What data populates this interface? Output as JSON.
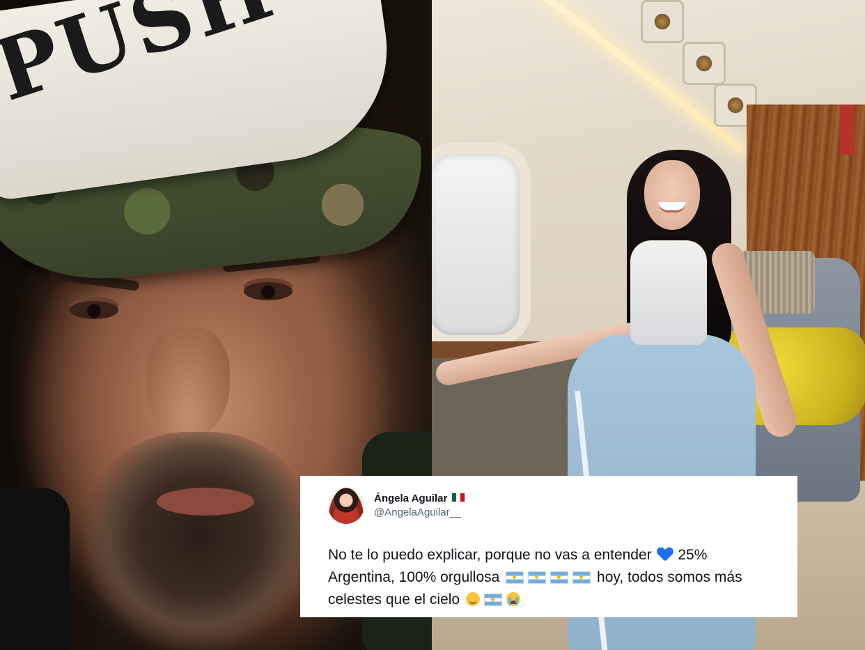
{
  "left_photo": {
    "cap_text": "PUSH"
  },
  "tweet": {
    "display_name": "Ángela Aguilar",
    "handle": "@AngelaAguilar__",
    "text_part1": "No te lo puedo explicar, porque no vas a entender",
    "text_part2": "25% Argentina, 100% orgullosa",
    "text_part3": "hoy, todos somos más celestes que el cielo"
  },
  "colors": {
    "tweet_background": "#ffffff",
    "tweet_text": "#0f1419",
    "handle_text": "#536471",
    "heart_emoji": "#1d6ff2"
  },
  "icons": [
    "flag-mexico-icon",
    "blue-heart-icon",
    "flag-argentina-icon",
    "smiling-face-icon",
    "crying-face-icon"
  ]
}
